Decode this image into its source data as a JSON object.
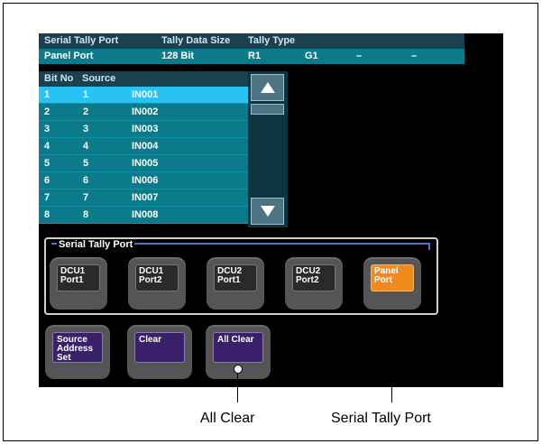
{
  "header": {
    "col_serial_tally_port": "Serial Tally Port",
    "col_tally_data_size": "Tally Data Size",
    "col_tally_type": "Tally Type",
    "port_value": "Panel Port",
    "data_size_value": "128 Bit",
    "tally_type_values": [
      "R1",
      "G1",
      "–",
      "–"
    ]
  },
  "bit_list": {
    "col_bit_no": "Bit No",
    "col_source": "Source",
    "rows": [
      {
        "bit": "1",
        "source_no": "1",
        "source_name": "IN001"
      },
      {
        "bit": "2",
        "source_no": "2",
        "source_name": "IN002"
      },
      {
        "bit": "3",
        "source_no": "3",
        "source_name": "IN003"
      },
      {
        "bit": "4",
        "source_no": "4",
        "source_name": "IN004"
      },
      {
        "bit": "5",
        "source_no": "5",
        "source_name": "IN005"
      },
      {
        "bit": "6",
        "source_no": "6",
        "source_name": "IN006"
      },
      {
        "bit": "7",
        "source_no": "7",
        "source_name": "IN007"
      },
      {
        "bit": "8",
        "source_no": "8",
        "source_name": "IN008"
      }
    ],
    "selected_index": 0
  },
  "scroll": {
    "up_icon": "up-arrow-icon",
    "down_icon": "down-arrow-icon"
  },
  "serial_tally_group": {
    "title": "Serial Tally Port",
    "buttons": [
      {
        "line1": "DCU1",
        "line2": "Port1",
        "active": false
      },
      {
        "line1": "DCU1",
        "line2": "Port2",
        "active": false
      },
      {
        "line1": "DCU2",
        "line2": "Port1",
        "active": false
      },
      {
        "line1": "DCU2",
        "line2": "Port2",
        "active": false
      },
      {
        "line1": "Panel Port",
        "line2": "",
        "active": true
      }
    ]
  },
  "actions": {
    "source_address_set": [
      "Source",
      "Address",
      "Set"
    ],
    "clear": "Clear",
    "all_clear": "All Clear"
  },
  "callouts": {
    "all_clear": "All Clear",
    "serial_tally_port": "Serial Tally Port"
  },
  "colors": {
    "header_dark": "#1b4150",
    "row_teal": "#0b7b8b",
    "row_selected": "#27c3f5",
    "active_orange": "#f08a1a",
    "action_purple": "#3a1f6b"
  }
}
